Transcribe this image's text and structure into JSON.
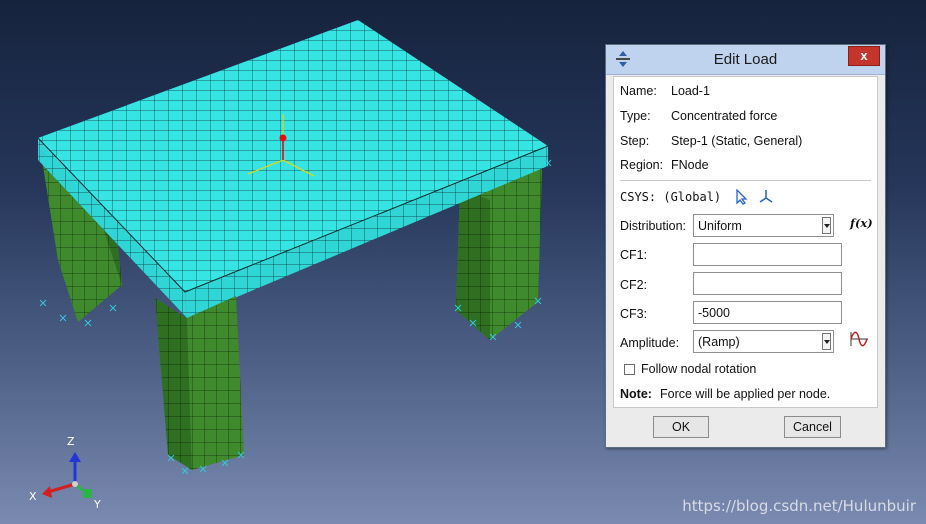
{
  "dialog": {
    "title": "Edit Load",
    "close_glyph": "x",
    "name_label": "Name:",
    "name_value": "Load-1",
    "type_label": "Type:",
    "type_value": "Concentrated force",
    "step_label": "Step:",
    "step_value": "Step-1 (Static, General)",
    "region_label": "Region:",
    "region_value": "FNode",
    "csys_label": "CSYS: (Global)",
    "distribution_label": "Distribution:",
    "distribution_value": "Uniform",
    "fx_glyph": "f(x)",
    "cf1_label": "CF1:",
    "cf1_value": "",
    "cf2_label": "CF2:",
    "cf2_value": "",
    "cf3_label": "CF3:",
    "cf3_value": "-5000",
    "amplitude_label": "Amplitude:",
    "amplitude_value": "(Ramp)",
    "follow_label": "Follow nodal rotation",
    "follow_checked": false,
    "note_bold": "Note:",
    "note_text": "Force will be applied per node.",
    "ok_label": "OK",
    "cancel_label": "Cancel"
  },
  "viewport": {
    "triad": {
      "z": "Z",
      "x": "X",
      "y": "Y"
    },
    "watermark": "https://blog.csdn.net/Hulunbuir",
    "colors": {
      "slab": "#36e4e4",
      "legs": "#3f8a2c",
      "mesh": "#0c2e2e",
      "load_point": "#e01010",
      "bc_marks": "#35c6d8"
    }
  },
  "icons": [
    "app-icon",
    "select-arrow-icon",
    "csys-triad-icon",
    "fx-icon",
    "amplitude-curve-icon",
    "dropdown-arrow-icon"
  ]
}
